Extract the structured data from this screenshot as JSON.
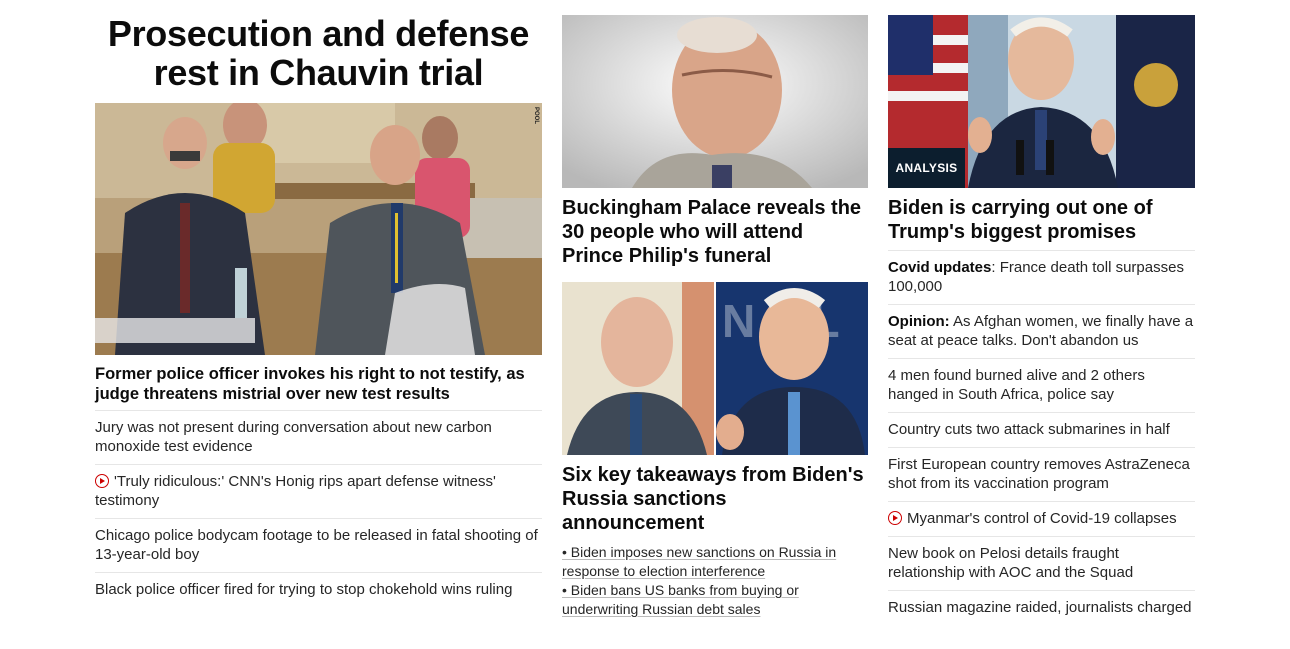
{
  "col1": {
    "banner": "Prosecution and defense rest in Chauvin trial",
    "image_credit": "POOL",
    "headline": "Former police officer invokes his right to not testify, as judge threatens mistrial over new test results",
    "items": [
      {
        "text": "Jury was not present during conversation about new carbon monoxide test evidence",
        "video": false
      },
      {
        "text": "'Truly ridiculous:' CNN's Honig rips apart defense witness' testimony",
        "video": true
      },
      {
        "text": "Chicago police bodycam footage to be released in fatal shooting of 13-year-old boy",
        "video": false
      },
      {
        "text": "Black police officer fired for trying to stop chokehold wins ruling",
        "video": false
      }
    ]
  },
  "col2": {
    "story1": {
      "headline": "Buckingham Palace reveals the 30 people who will attend Prince Philip's funeral"
    },
    "story2": {
      "headline": "Six key takeaways from Biden's Russia sanctions announcement",
      "sublinks": [
        "• Biden imposes new sanctions on Russia in response to election interference",
        "• Biden bans US banks from buying or underwriting Russian debt sales"
      ]
    }
  },
  "col3": {
    "badge": "ANALYSIS",
    "headline": "Biden is carrying out one of Trump's biggest promises",
    "items": [
      {
        "prefix": "Covid updates",
        "text": ": France death toll surpasses 100,000",
        "video": false
      },
      {
        "prefix": "Opinion:",
        "text": " As Afghan women, we finally have a seat at peace talks. Don't abandon us",
        "video": false
      },
      {
        "prefix": "",
        "text": "4 men found burned alive and 2 others hanged in South Africa, police say",
        "video": false
      },
      {
        "prefix": "",
        "text": "Country cuts two attack submarines in half",
        "video": false
      },
      {
        "prefix": "",
        "text": "First European country removes AstraZeneca shot from its vaccination program",
        "video": false
      },
      {
        "prefix": "",
        "text": "Myanmar's control of Covid-19 collapses",
        "video": true
      },
      {
        "prefix": "",
        "text": "New book on Pelosi details fraught relationship with AOC and the Squad",
        "video": false
      },
      {
        "prefix": "",
        "text": "Russian magazine raided, journalists charged",
        "video": false
      }
    ]
  }
}
